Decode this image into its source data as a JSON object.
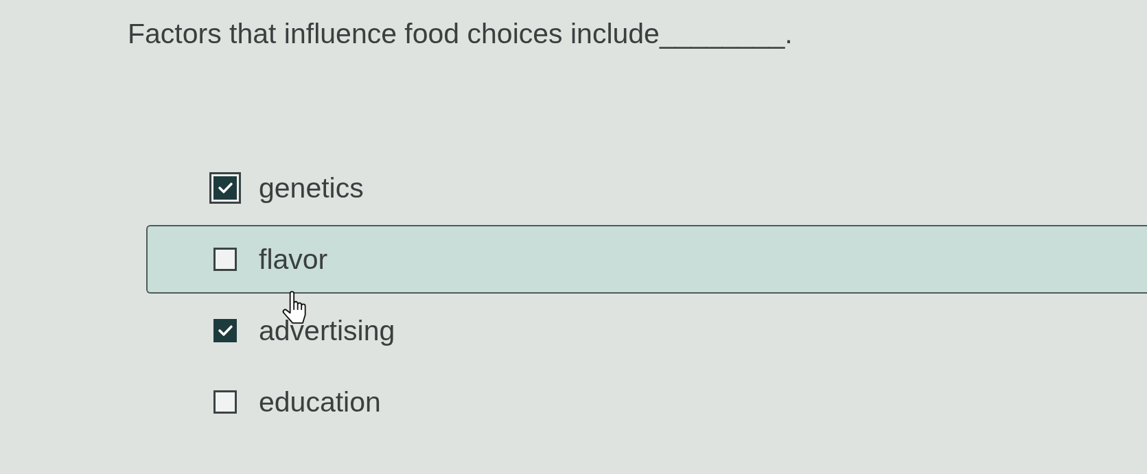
{
  "question": {
    "text": "Factors that influence food choices include________."
  },
  "options": [
    {
      "label": "genetics",
      "checked": true,
      "focused": true,
      "hovered": false
    },
    {
      "label": "flavor",
      "checked": false,
      "focused": false,
      "hovered": true
    },
    {
      "label": "advertising",
      "checked": true,
      "focused": false,
      "hovered": false
    },
    {
      "label": "education",
      "checked": false,
      "focused": false,
      "hovered": false
    }
  ]
}
